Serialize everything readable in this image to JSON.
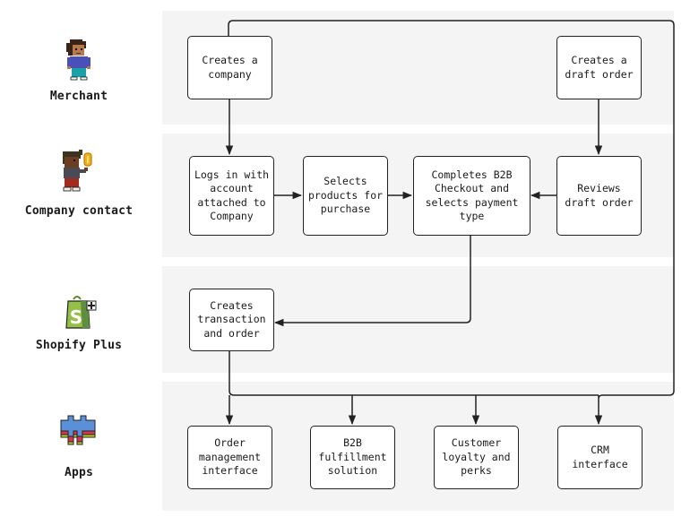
{
  "lanes": [
    {
      "actor": "Merchant",
      "icon": "merchant-character-icon"
    },
    {
      "actor": "Company contact",
      "icon": "company-contact-character-icon"
    },
    {
      "actor": "Shopify Plus",
      "icon": "shopify-plus-bag-icon"
    },
    {
      "actor": "Apps",
      "icon": "puzzle-pieces-icon"
    }
  ],
  "steps": {
    "creates_company": "Creates a\ncompany",
    "creates_draft_order": "Creates a\ndraft order",
    "logs_in": "Logs in with\naccount\nattached to\nCompany",
    "selects_products": "Selects\nproducts for\npurchase",
    "completes_checkout": "Completes B2B\nCheckout and\nselects payment\ntype",
    "reviews_draft": "Reviews\ndraft order",
    "creates_transaction": "Creates\ntransaction\nand order",
    "order_management": "Order\nmanagement\ninterface",
    "b2b_fulfillment": "B2B\nfulfillment\nsolution",
    "customer_loyalty": "Customer\nloyalty and\nperks",
    "crm_interface": "CRM\ninterface"
  },
  "colors": {
    "lane_bg": "#f4f4f4",
    "line": "#222222",
    "shopify_green": "#95bf47"
  }
}
